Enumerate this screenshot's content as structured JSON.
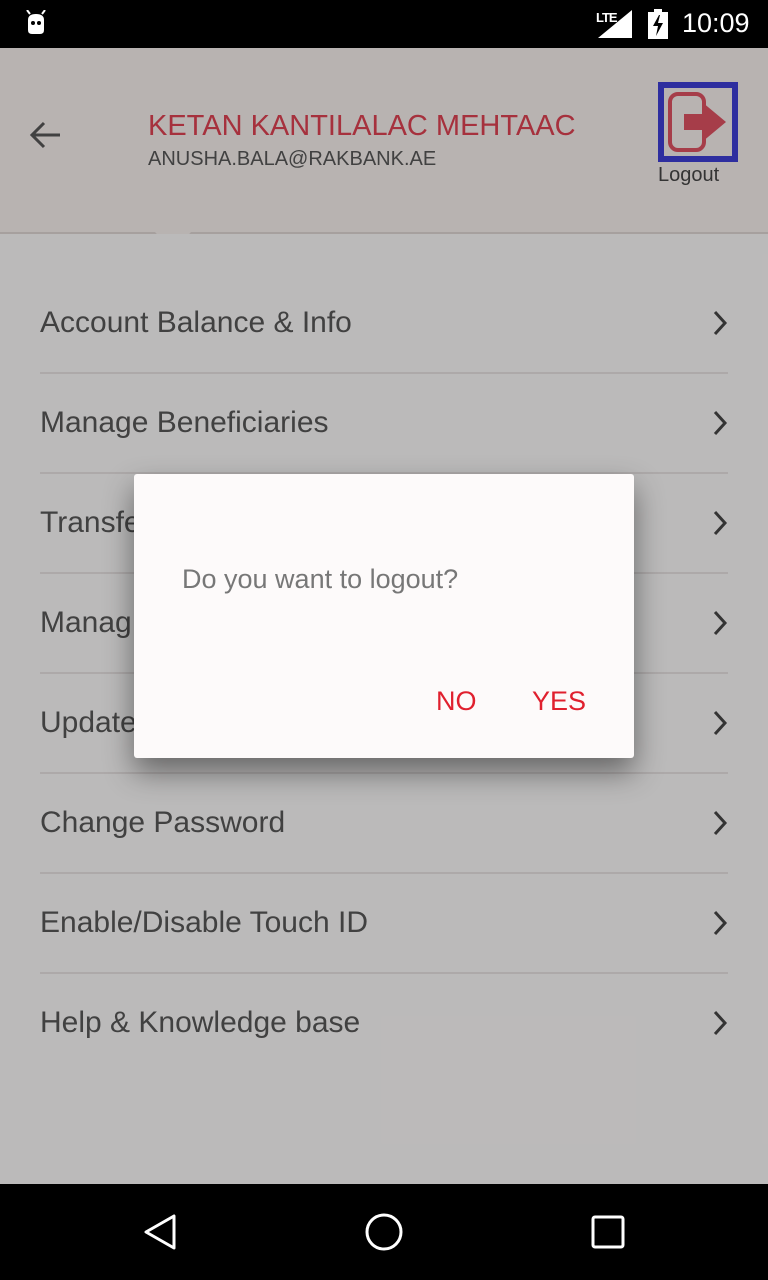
{
  "status_bar": {
    "network": "LTE",
    "time": "10:09",
    "icons": [
      "android-icon",
      "signal-icon",
      "battery-charging-icon"
    ]
  },
  "header": {
    "user_name": "KETAN KANTILALAC MEHTAAC",
    "email": "ANUSHA.BALA@RAKBANK.AE",
    "logout_label": "Logout",
    "icons": [
      "back-arrow-icon",
      "logout-icon"
    ]
  },
  "menu": {
    "items": [
      {
        "label": "Account Balance & Info"
      },
      {
        "label": "Manage Beneficiaries"
      },
      {
        "label": "Transfe"
      },
      {
        "label": "Manag"
      },
      {
        "label": "Update"
      },
      {
        "label": "Change Password"
      },
      {
        "label": "Enable/Disable Touch ID"
      },
      {
        "label": "Help & Knowledge base"
      }
    ]
  },
  "dialog": {
    "message": "Do you want to logout?",
    "no_label": "NO",
    "yes_label": "YES"
  },
  "colors": {
    "accent": "#e0202e",
    "name_red": "#d84050",
    "highlight_box": "#3c3ccf",
    "header_bg": "#f0e9e7"
  }
}
